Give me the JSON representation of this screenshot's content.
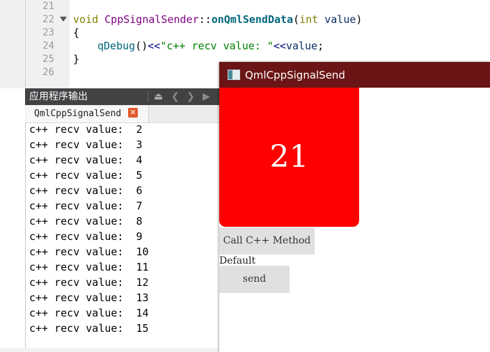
{
  "editor": {
    "line_numbers": [
      "21",
      "22",
      "23",
      "24",
      "25",
      "26"
    ],
    "line22": {
      "kw": "void",
      "cls": "CppSignalSender",
      "sep": "::",
      "fn": "onQmlSendData",
      "open": "(",
      "param_type": "int",
      "param_name": "value",
      "close": ")"
    },
    "line23": "{",
    "line24": {
      "call": "qDebug",
      "parens": "()",
      "op": "<<",
      "str": "\"c++ recv value: \"",
      "op2": "<<",
      "var": "value",
      "end": ";"
    },
    "line25": "}"
  },
  "output_panel": {
    "title": "应用程序输出",
    "tab_label": "QmlCppSignalSend",
    "lines": [
      "c++ recv value:  2",
      "c++ recv value:  3",
      "c++ recv value:  4",
      "c++ recv value:  5",
      "c++ recv value:  6",
      "c++ recv value:  7",
      "c++ recv value:  8",
      "c++ recv value:  9",
      "c++ recv value:  10",
      "c++ recv value:  11",
      "c++ recv value:  12",
      "c++ recv value:  13",
      "c++ recv value:  14",
      "c++ recv value:  15"
    ]
  },
  "app_window": {
    "title": "QmlCppSignalSend",
    "counter": "21",
    "call_button": "Call C++ Method",
    "default_label": "Default",
    "send_button": "send",
    "colors": {
      "title_bar": "#6b1517",
      "rect": "#ff0000"
    }
  }
}
